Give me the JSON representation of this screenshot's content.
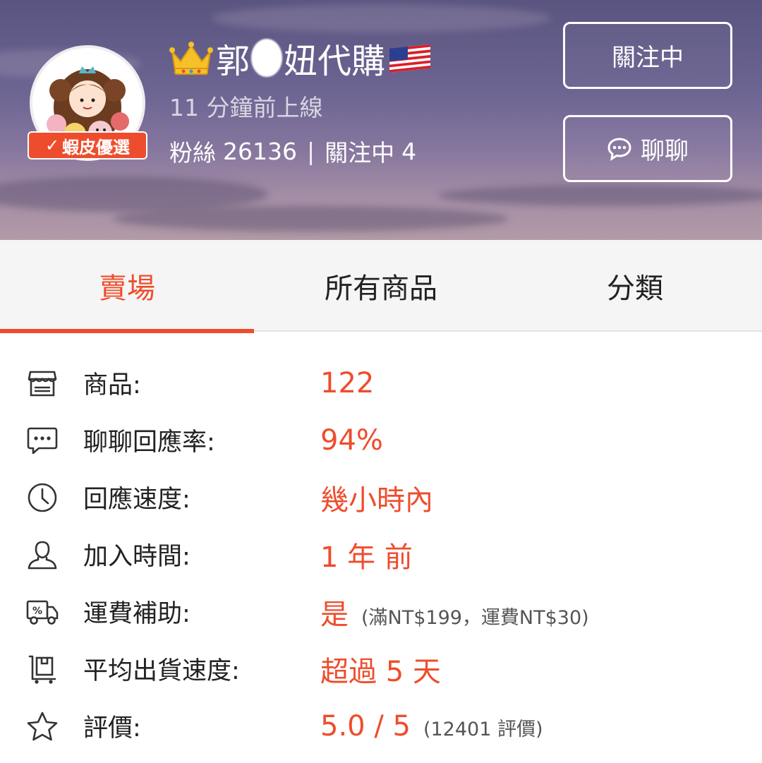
{
  "header": {
    "shop_name_prefix": "郭",
    "shop_name_suffix": "妞代購",
    "online_status": "11 分鐘前上線",
    "followers_label": "粉絲",
    "followers_count": "26136",
    "separator": "|",
    "following_label": "關注中",
    "following_count": "4",
    "badge_text": "蝦皮優選",
    "follow_button": "關注中",
    "chat_button": "聊聊",
    "crown_icon": "crown-icon",
    "flag_icon": "us-flag-icon"
  },
  "tabs": [
    {
      "label": "賣場",
      "active": true
    },
    {
      "label": "所有商品",
      "active": false
    },
    {
      "label": "分類",
      "active": false
    }
  ],
  "info": [
    {
      "icon": "store-icon",
      "label": "商品:",
      "value": "122",
      "note": ""
    },
    {
      "icon": "chat-bubble-icon",
      "label": "聊聊回應率:",
      "value": "94%",
      "note": ""
    },
    {
      "icon": "clock-icon",
      "label": "回應速度:",
      "value": "幾小時內",
      "note": ""
    },
    {
      "icon": "user-icon",
      "label": "加入時間:",
      "value": "1 年 前",
      "note": ""
    },
    {
      "icon": "shipping-truck-icon",
      "label": "運費補助:",
      "value": "是",
      "note": "(滿NT$199，運費NT$30)"
    },
    {
      "icon": "package-cart-icon",
      "label": "平均出貨速度:",
      "value": "超過 5 天",
      "note": ""
    },
    {
      "icon": "star-icon",
      "label": "評價:",
      "value": "5.0 / 5",
      "note": "(12401 評價)"
    }
  ],
  "colors": {
    "accent": "#ee4d2d",
    "header_top": "#5a5580",
    "header_bottom": "#b39aa6"
  }
}
